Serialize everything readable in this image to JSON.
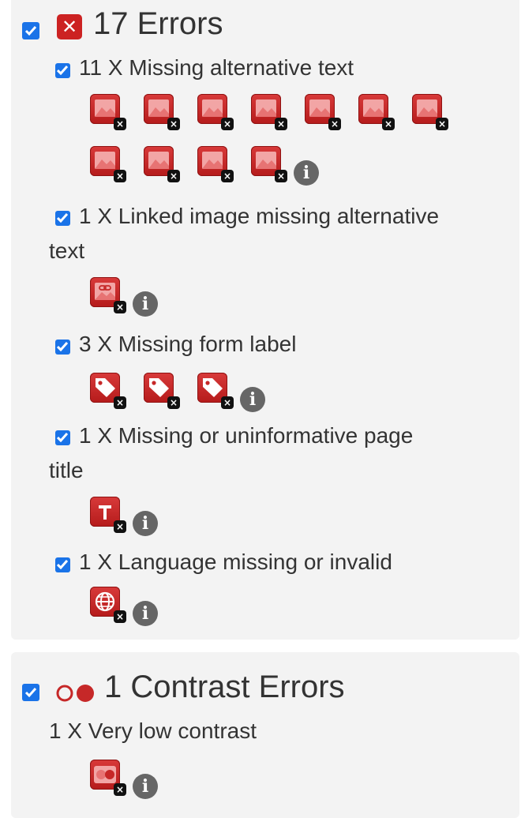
{
  "errors_section": {
    "heading": "17 Errors",
    "items": [
      {
        "label": "11 X Missing alternative text",
        "icon_count": 11,
        "icon": "missing-alt-image-icon"
      },
      {
        "label_line1": "1 X Linked image missing alternative",
        "label_line2": "text",
        "icon_count": 1,
        "icon": "linked-image-icon"
      },
      {
        "label": "3 X Missing form label",
        "icon_count": 3,
        "icon": "tag-icon"
      },
      {
        "label_line1": "1 X Missing or uninformative page",
        "label_line2": "title",
        "icon_count": 1,
        "icon": "title-t-icon"
      },
      {
        "label": "1 X Language missing or invalid",
        "icon_count": 1,
        "icon": "globe-icon"
      }
    ]
  },
  "contrast_section": {
    "heading": "1 Contrast Errors",
    "items": [
      {
        "label": "1 X Very low contrast",
        "icon_count": 1,
        "icon": "contrast-icon"
      }
    ]
  },
  "icons": {
    "badge_glyph": "×",
    "info_glyph": "i",
    "x_glyph": "✕"
  },
  "colors": {
    "checkbox_blue": "#1a73e8",
    "error_red": "#c62828",
    "panel_bg": "#f3f3f3",
    "text": "#333333",
    "info_gray": "#666666"
  }
}
